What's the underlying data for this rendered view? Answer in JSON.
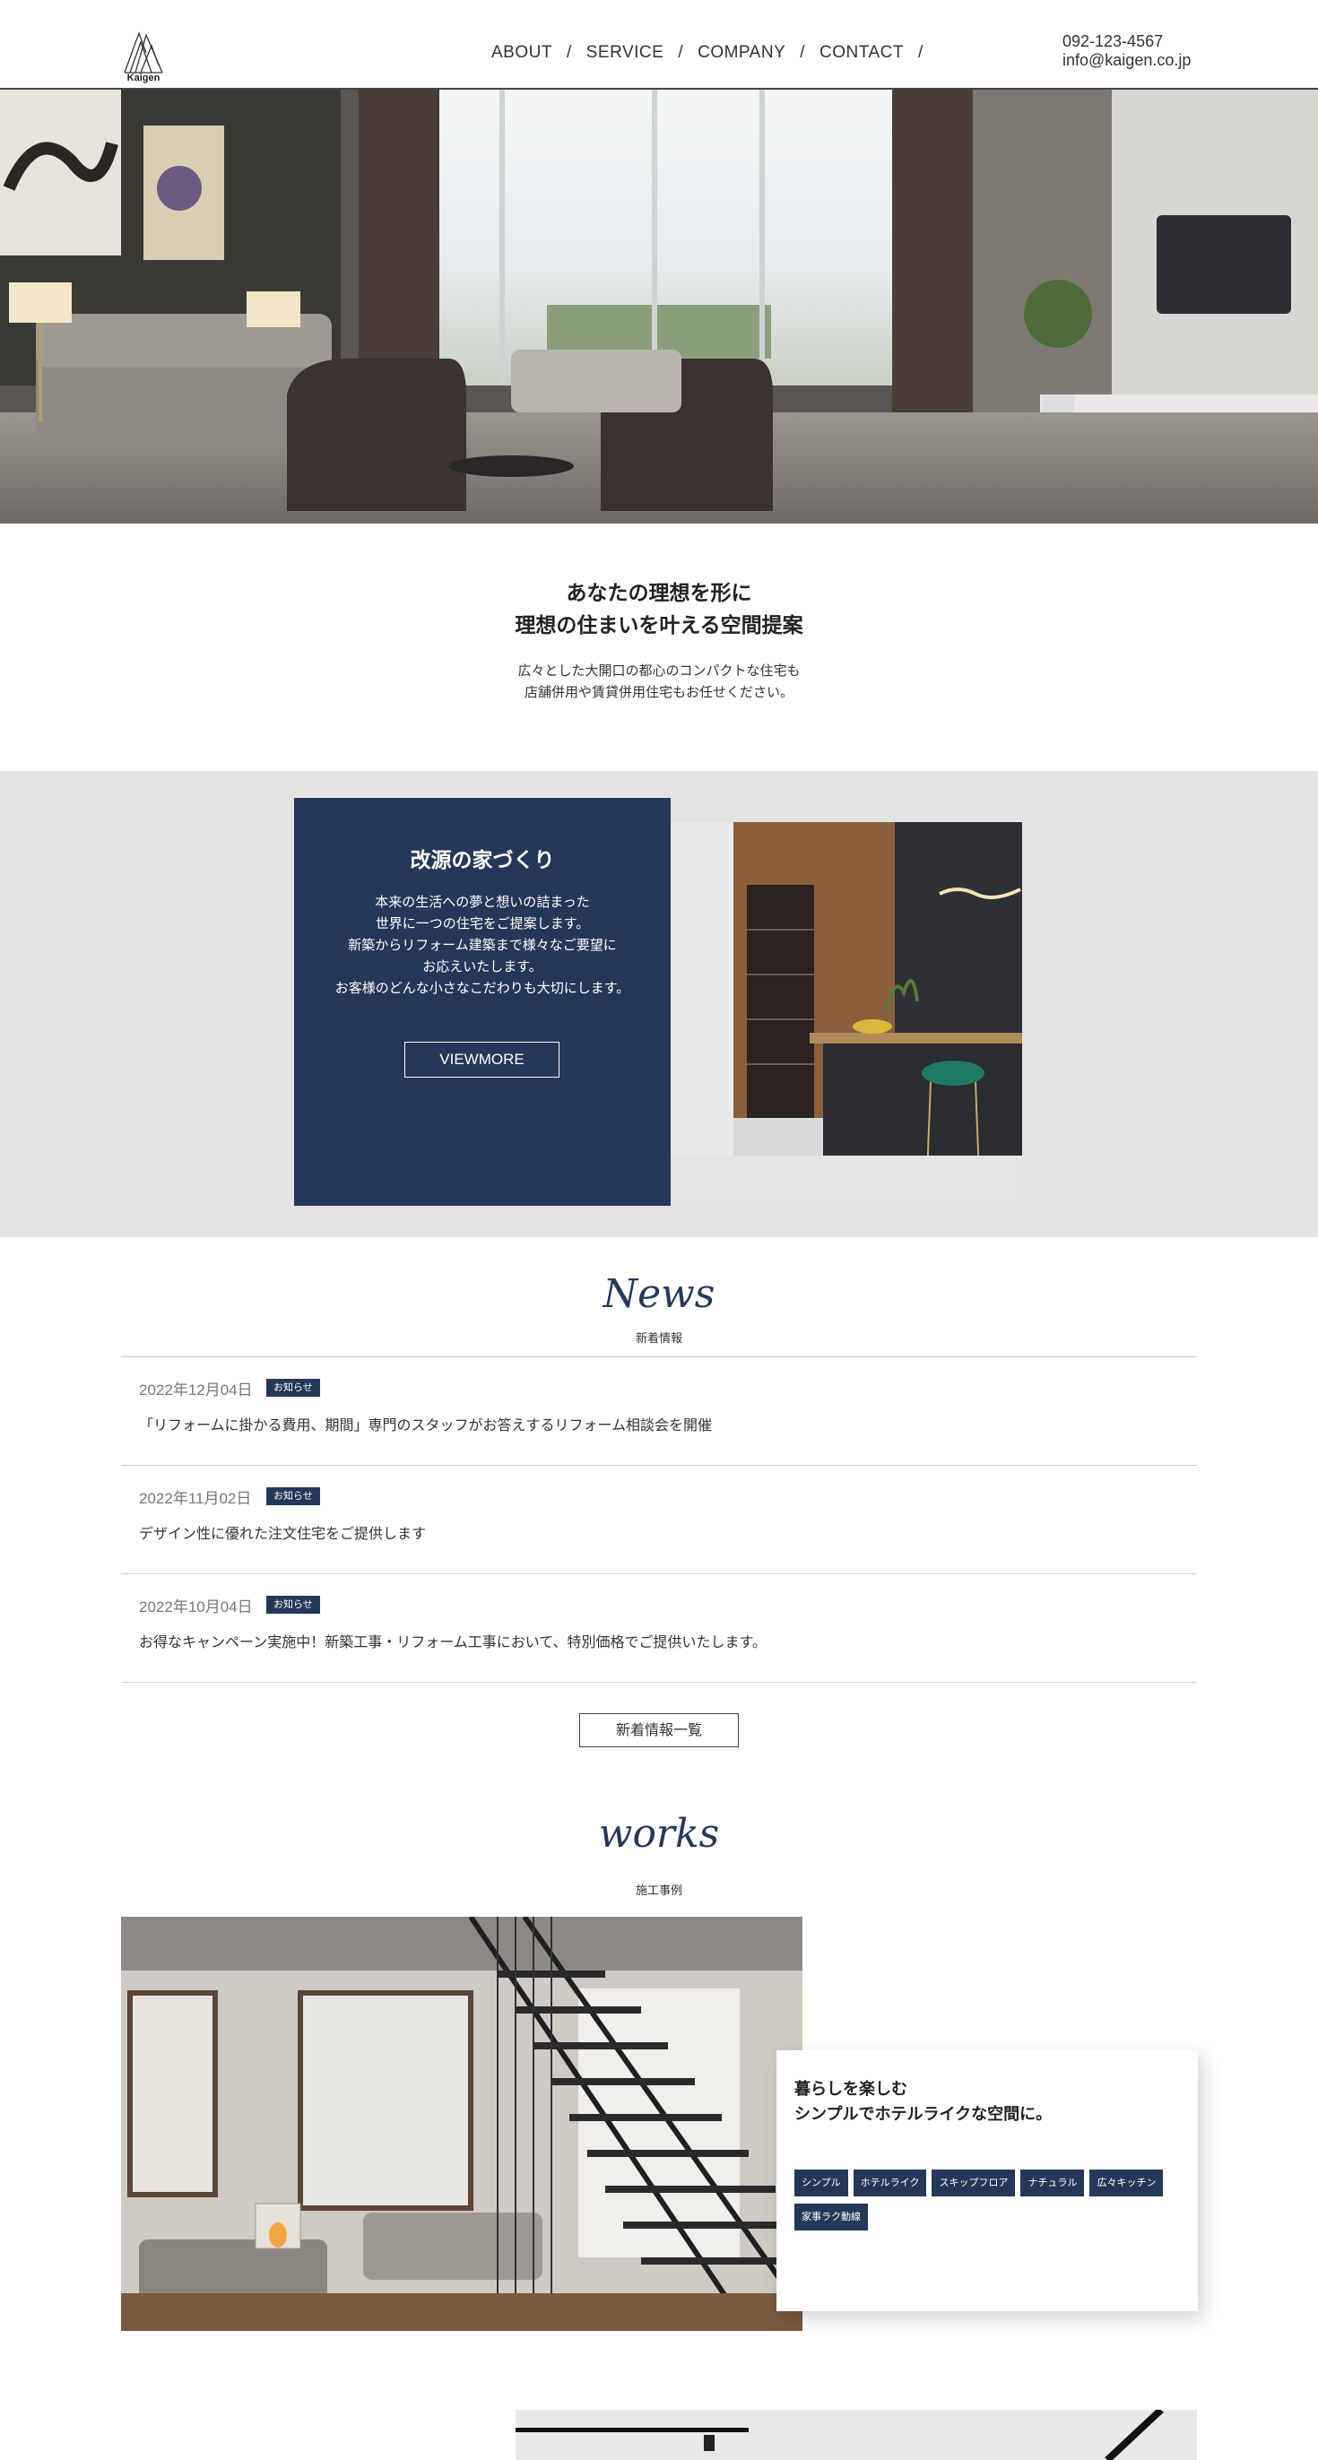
{
  "header": {
    "logo_text": "Kaigen",
    "nav": [
      {
        "label": "ABOUT"
      },
      {
        "label": "SERVICE"
      },
      {
        "label": "COMPANY"
      },
      {
        "label": "CONTACT"
      }
    ],
    "separator": "/",
    "phone": "092-123-4567",
    "email": "info@kaigen.co.jp"
  },
  "intro": {
    "title_line1": "あなたの理想を形に",
    "title_line2": "理想の住まいを叶える空間提案",
    "text_line1": "広々とした大開口の都心のコンパクトな住宅も",
    "text_line2": "店舗併用や賃貸併用住宅もお任せください。"
  },
  "feature": {
    "title": "改源の家づくり",
    "lines": [
      "本来の生活への夢と想いの詰まった",
      "世界に一つの住宅をご提案します。",
      "新築からリフォーム建築まで様々なご要望に",
      "お応えいたします。",
      "お客様のどんな小さなこだわりも大切にします。"
    ],
    "button": "VIEWMORE"
  },
  "news": {
    "heading": "News",
    "subheading": "新着情報",
    "items": [
      {
        "date": "2022年12月04日",
        "badge": "お知らせ",
        "title": "「リフォームに掛かる費用、期間」専門のスタッフがお答えするリフォーム相談会を開催"
      },
      {
        "date": "2022年11月02日",
        "badge": "お知らせ",
        "title": "デザイン性に優れた注文住宅をご提供します"
      },
      {
        "date": "2022年10月04日",
        "badge": "お知らせ",
        "title": "お得なキャンペーン実施中！新築工事・リフォーム工事において、特別価格でご提供いたします。"
      }
    ],
    "more_button": "新着情報一覧"
  },
  "works": {
    "heading": "works",
    "subheading": "施工事例",
    "title_line1": "暮らしを楽しむ",
    "title_line2": "シンプルでホテルライクな空間に。",
    "tags": [
      "シンプル",
      "ホテルライク",
      "スキップフロア",
      "ナチュラル",
      "広々キッチン",
      "家事ラク動線"
    ]
  },
  "colors": {
    "navy": "#253859",
    "band_gray": "#e3e3e3"
  }
}
